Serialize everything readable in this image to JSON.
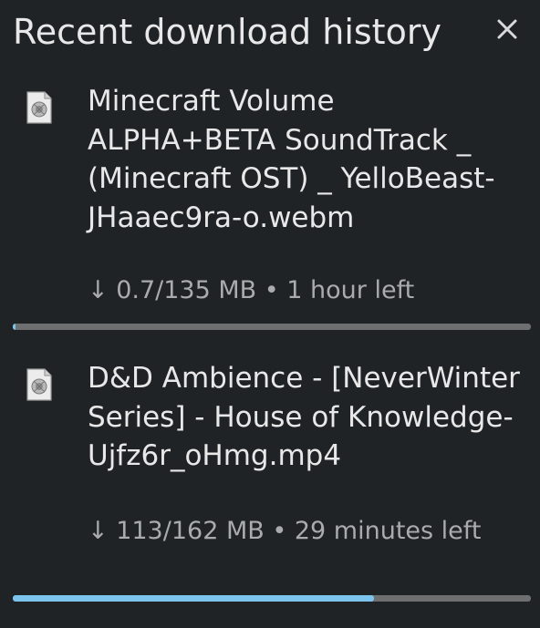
{
  "panel": {
    "title": "Recent download history",
    "close_icon": "close-icon"
  },
  "downloads": [
    {
      "file_icon": "file-icon",
      "name": "Minecraft Volume ALPHA+BETA SoundTrack _ (Minecraft OST) _ YelloBeast-JHaaec9ra-o.webm",
      "status": "↓ 0.7/135 MB • 1 hour left",
      "progress": 0.005
    },
    {
      "file_icon": "file-icon",
      "name": "D&D Ambience - [NeverWinter Series] - House of Knowledge-Ujfz6r_oHmg.mp4",
      "status": "↓ 113/162 MB • 29 minutes left",
      "progress": 0.698
    }
  ],
  "colors": {
    "background": "#1f2326",
    "text": "#e8e8e8",
    "muted_text": "#a9abad",
    "progress_track": "#6d6f71",
    "progress_fill": "#7cc4ee"
  }
}
